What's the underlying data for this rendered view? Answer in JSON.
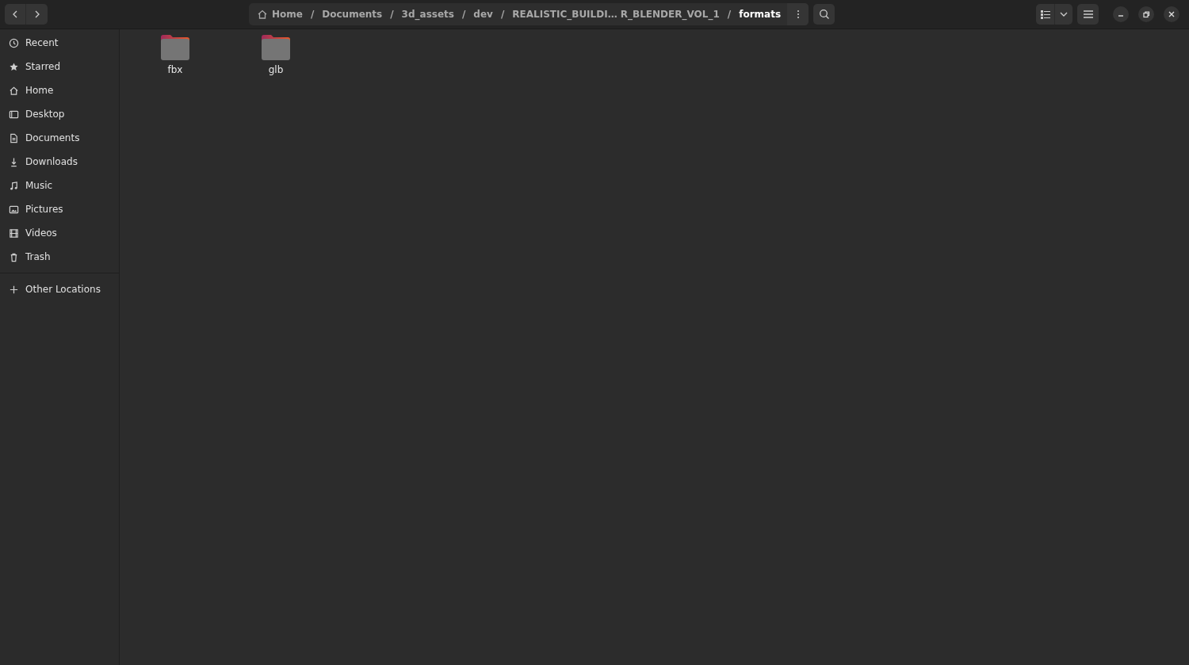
{
  "breadcrumb": [
    {
      "label": "Home",
      "kind": "home",
      "selected": false
    },
    {
      "label": "Documents",
      "kind": "folder",
      "selected": false
    },
    {
      "label": "3d_assets",
      "kind": "folder",
      "selected": false
    },
    {
      "label": "dev",
      "kind": "folder",
      "selected": false
    },
    {
      "label": "REALISTIC_BUILDI… R_BLENDER_VOL_1",
      "kind": "folder",
      "selected": false
    },
    {
      "label": "formats",
      "kind": "folder",
      "selected": true
    }
  ],
  "separator": "/",
  "sidebar": {
    "items": [
      {
        "label": "Recent",
        "kind": "recent",
        "selected": false
      },
      {
        "label": "Starred",
        "kind": "starred",
        "selected": false
      },
      {
        "label": "Home",
        "kind": "home",
        "selected": false
      },
      {
        "label": "Desktop",
        "kind": "desktop",
        "selected": false
      },
      {
        "label": "Documents",
        "kind": "documents",
        "selected": false
      },
      {
        "label": "Downloads",
        "kind": "downloads",
        "selected": false
      },
      {
        "label": "Music",
        "kind": "music",
        "selected": false
      },
      {
        "label": "Pictures",
        "kind": "pictures",
        "selected": false
      },
      {
        "label": "Videos",
        "kind": "videos",
        "selected": false
      },
      {
        "label": "Trash",
        "kind": "trash",
        "selected": false
      },
      {
        "label": "Other Locations",
        "kind": "other",
        "selected": false
      }
    ]
  },
  "files": [
    {
      "name": "fbx",
      "selected": false
    },
    {
      "name": "glb",
      "selected": false
    }
  ]
}
